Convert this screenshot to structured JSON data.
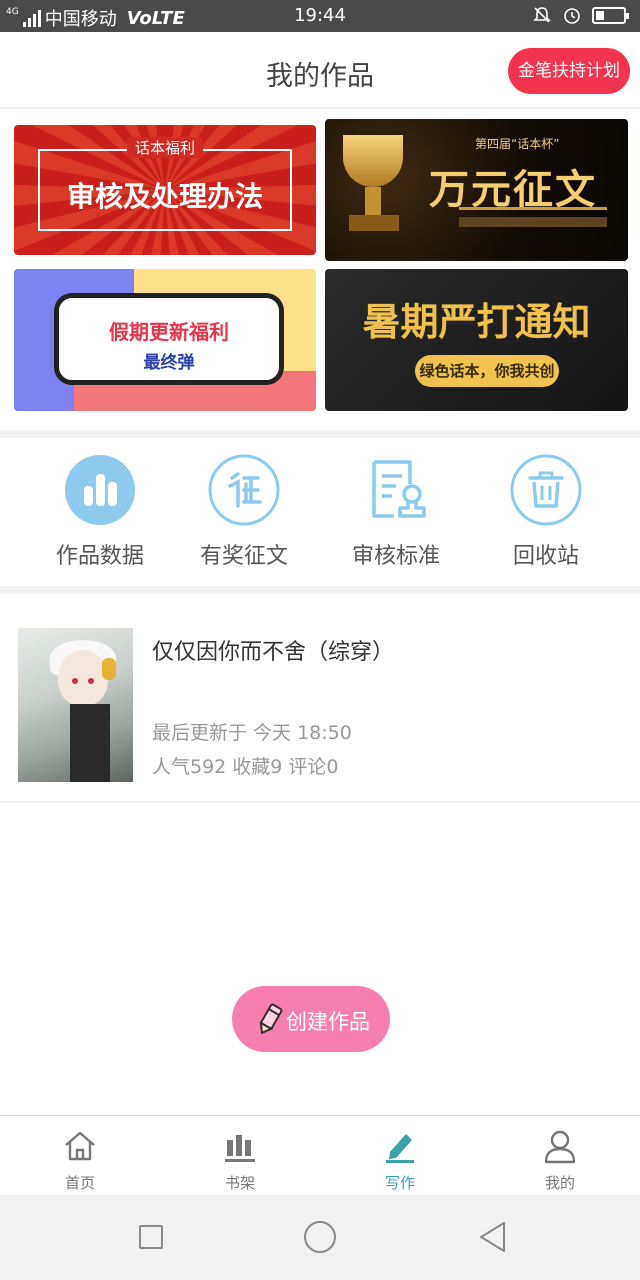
{
  "status_bar": {
    "network": "4G",
    "carrier": "中国移动",
    "volte": "VoLTE",
    "time": "19:44"
  },
  "header": {
    "title": "我的作品",
    "plan_button": "金笔扶持计划"
  },
  "banners": {
    "audit": {
      "tag": "话本福利",
      "title": "审核及处理办法"
    },
    "contest": {
      "subtitle": "第四届“话本杯”",
      "title": "万元征文"
    },
    "holiday": {
      "title": "假期更新福利",
      "subtitle": "最终弹"
    },
    "summer": {
      "title": "暑期严打通知",
      "subtitle": "绿色话本，你我共创"
    }
  },
  "quick_menu": [
    {
      "label": "作品数据",
      "icon": "bar-chart-icon"
    },
    {
      "label": "有奖征文",
      "icon": "contest-icon"
    },
    {
      "label": "审核标准",
      "icon": "audit-doc-icon"
    },
    {
      "label": "回收站",
      "icon": "trash-icon"
    }
  ],
  "work": {
    "title": "仅仅因你而不舍（综穿）",
    "updated": "最后更新于 今天 18:50",
    "stats": "人气592 收藏9 评论0"
  },
  "create_button": {
    "label": "创建作品"
  },
  "bottom_nav": [
    {
      "label": "首页",
      "icon": "home-icon"
    },
    {
      "label": "书架",
      "icon": "bookshelf-icon"
    },
    {
      "label": "写作",
      "icon": "pencil-icon"
    },
    {
      "label": "我的",
      "icon": "user-icon"
    }
  ],
  "colors": {
    "accent": "#3aa3a8",
    "plan_button": "#f2344c",
    "create_button": "#f77fb0",
    "quick_icon": "#8ec9ee"
  }
}
